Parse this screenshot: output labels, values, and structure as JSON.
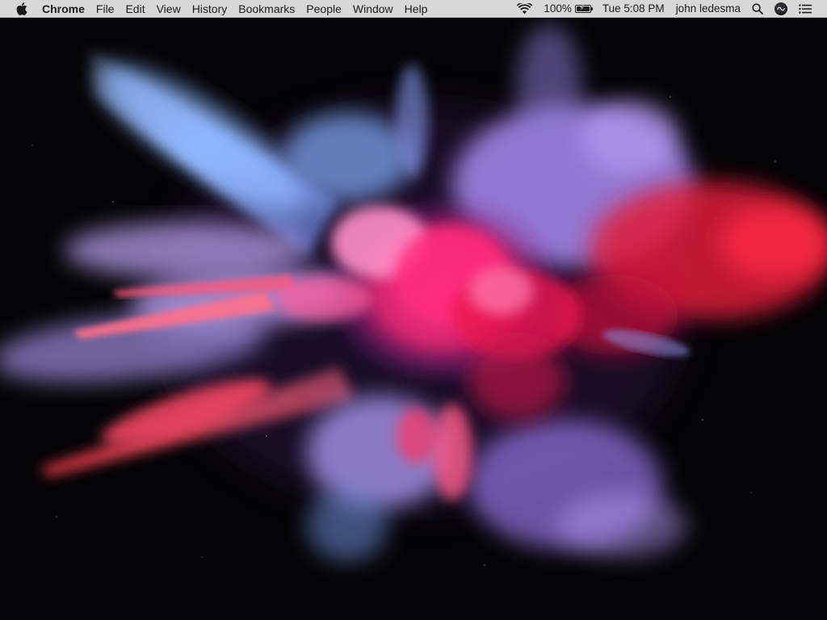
{
  "menubar": {
    "apple_icon": "apple-logo-icon",
    "app_name": "Chrome",
    "menus": [
      "File",
      "Edit",
      "View",
      "History",
      "Bookmarks",
      "People",
      "Window",
      "Help"
    ],
    "status": {
      "wifi_icon": "wifi-icon",
      "battery_percent_label": "100%",
      "battery_level": 1.0,
      "battery_charging": true,
      "clock": "Tue 5:08 PM",
      "user_name": "john ledesma",
      "spotlight_icon": "search-icon",
      "siri_icon": "siri-icon",
      "notification_icon": "notification-center-icon"
    }
  },
  "desktop": {
    "wallpaper": "colorful powder explosion on black",
    "colors": {
      "blue": "#7fa9f0",
      "violet": "#9b7fe6",
      "pink": "#ff4f9a",
      "red": "#ff2040"
    }
  }
}
